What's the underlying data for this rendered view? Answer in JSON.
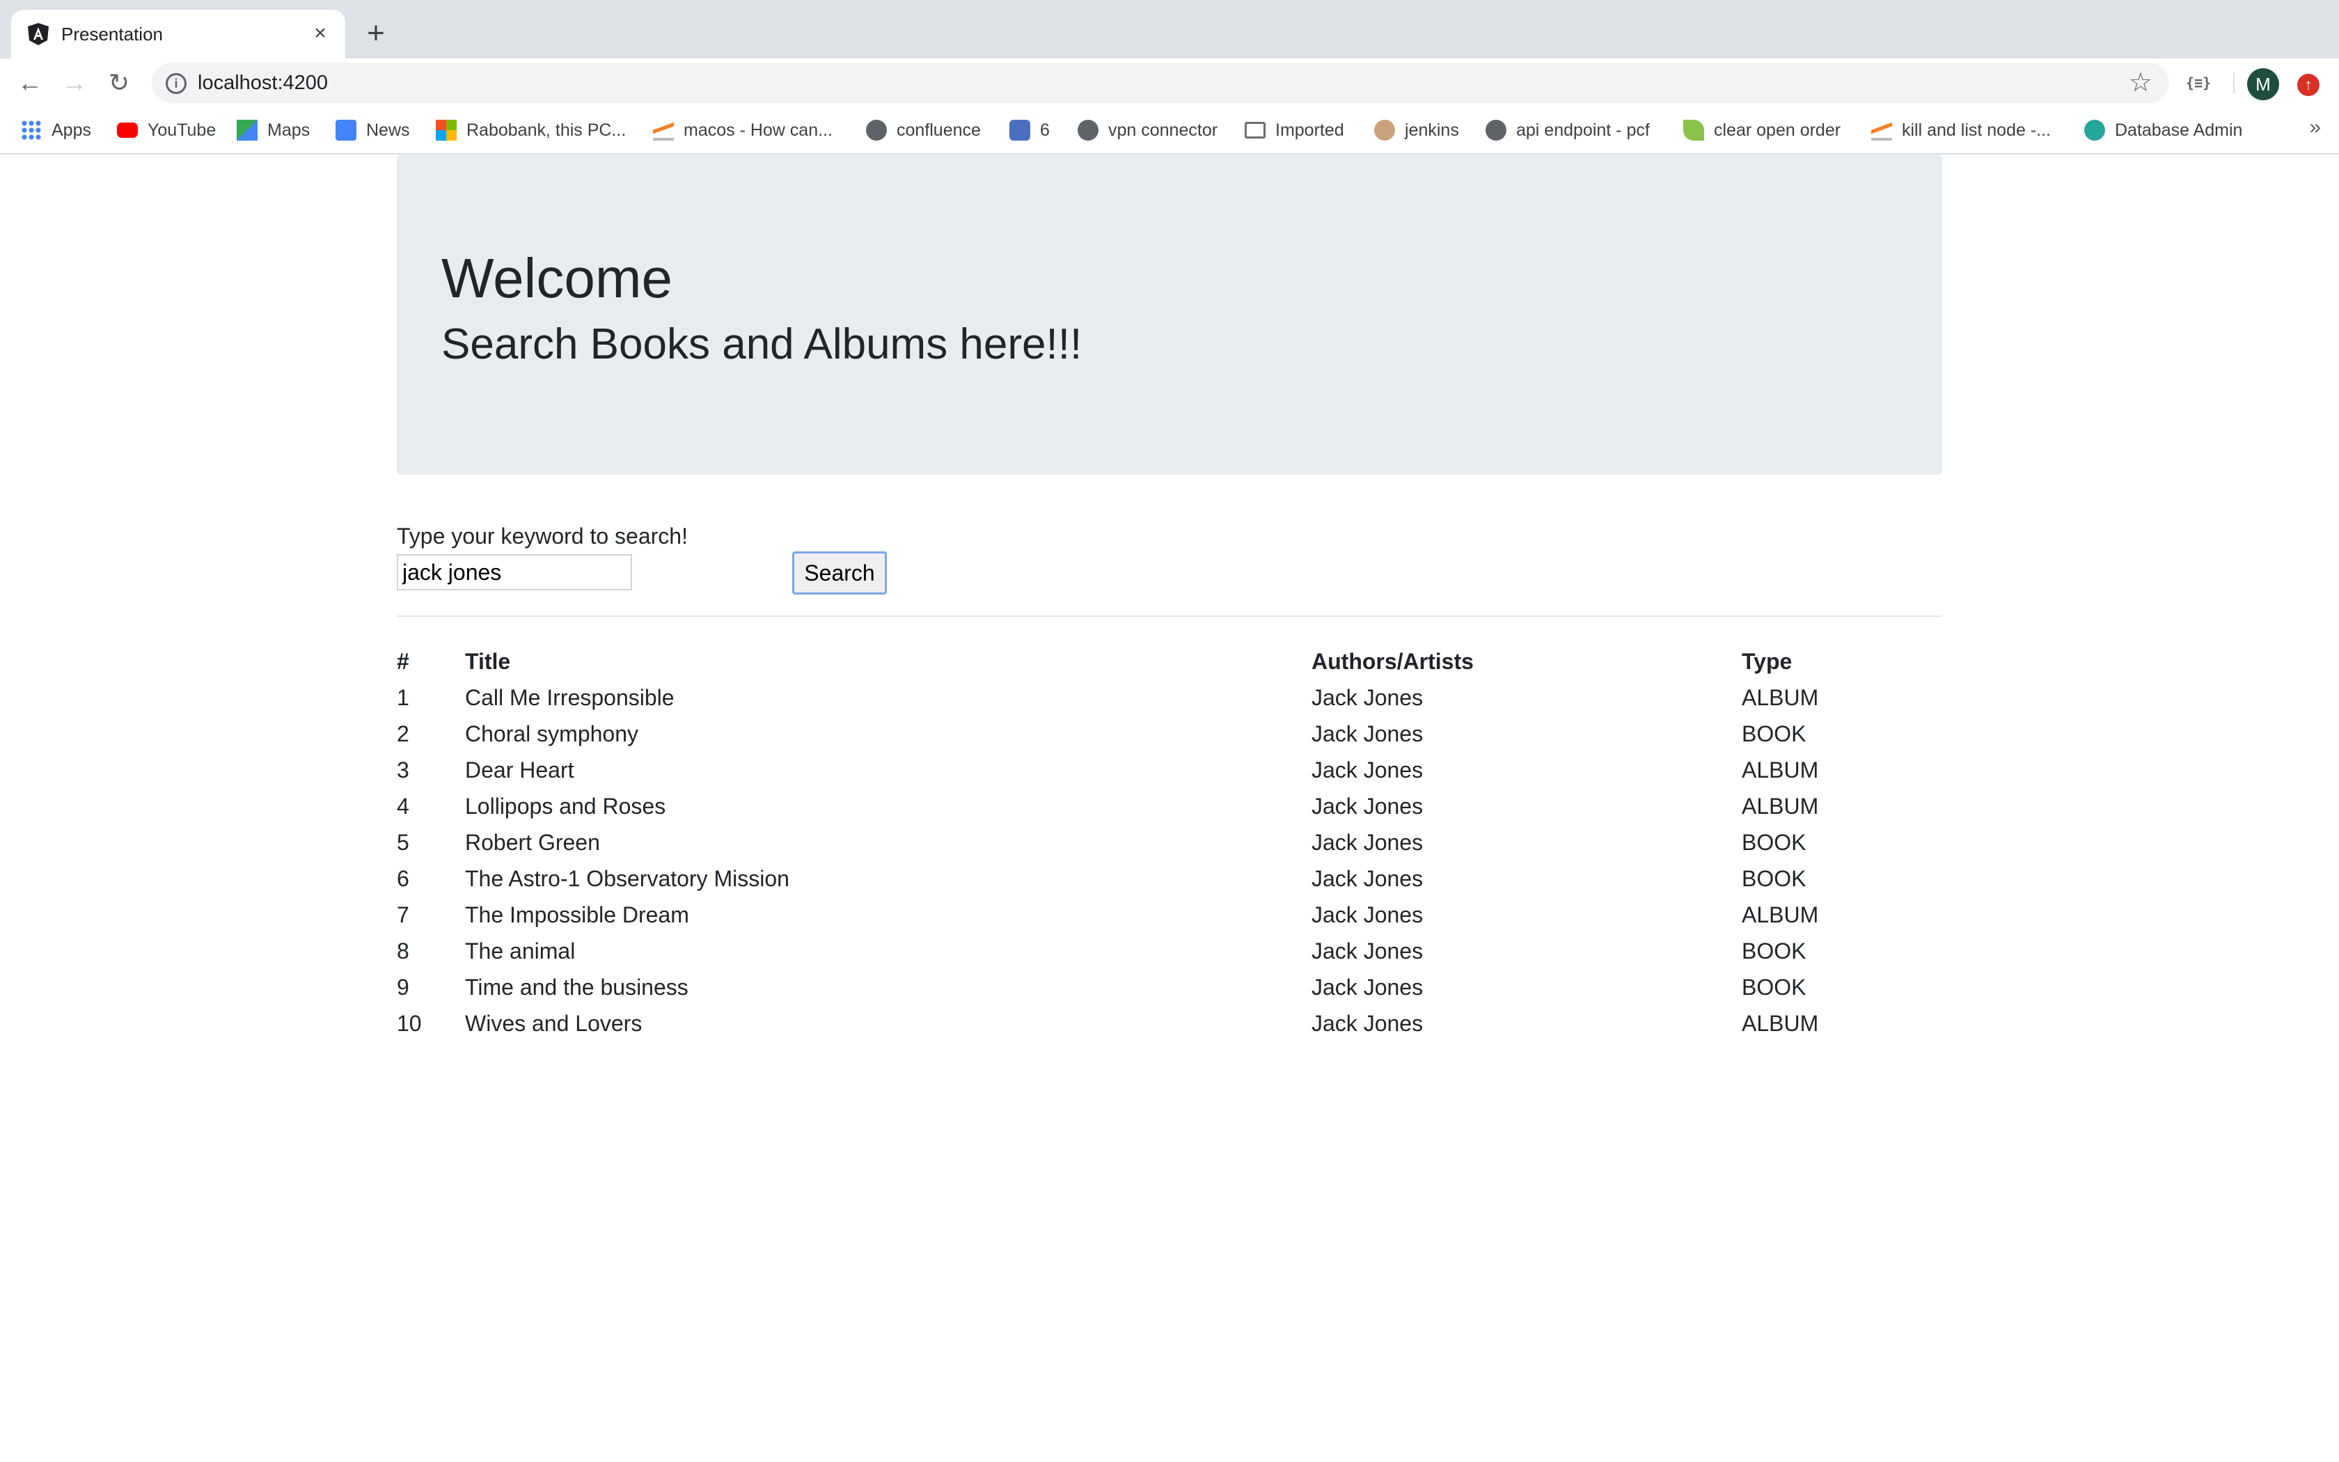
{
  "browser": {
    "tab_title": "Presentation",
    "tab_close": "×",
    "new_tab": "+",
    "url": "localhost:4200",
    "avatar_letter": "M",
    "ext_label": "{≡}"
  },
  "bookmarks": [
    {
      "label": "Apps",
      "icon": "apps-grid-icon",
      "color": "#4285f4"
    },
    {
      "label": "YouTube",
      "icon": "youtube-icon",
      "color": "#ff0000"
    },
    {
      "label": "Maps",
      "icon": "maps-icon",
      "color": "#34a853"
    },
    {
      "label": "News",
      "icon": "news-icon",
      "color": "#4285f4"
    },
    {
      "label": "Rabobank, this PC...",
      "icon": "windows-icon",
      "color": "#f25022"
    },
    {
      "label": "macos - How can...",
      "icon": "stackoverflow-icon",
      "color": "#f48024"
    },
    {
      "label": "confluence",
      "icon": "globe-icon",
      "color": "#5f6368"
    },
    {
      "label": "6",
      "icon": "robot-icon",
      "color": "#4a6fbf"
    },
    {
      "label": "vpn connector",
      "icon": "globe-icon",
      "color": "#5f6368"
    },
    {
      "label": "Imported",
      "icon": "folder-icon",
      "color": "#6e6e6e"
    },
    {
      "label": "jenkins",
      "icon": "jenkins-icon",
      "color": "#c9a27c"
    },
    {
      "label": "api endpoint - pcf",
      "icon": "globe-icon",
      "color": "#5f6368"
    },
    {
      "label": "clear open order",
      "icon": "leaf-icon",
      "color": "#8bc34a"
    },
    {
      "label": "kill and list node -...",
      "icon": "stackoverflow-icon",
      "color": "#f48024"
    },
    {
      "label": "Database Admin",
      "icon": "heartbeat-icon",
      "color": "#26a69a"
    }
  ],
  "page": {
    "welcome": "Welcome",
    "subtitle": "Search Books and Albums here!!!",
    "search_label": "Type your keyword to search!",
    "search_value": "jack jones",
    "search_button": "Search"
  },
  "table": {
    "headers": [
      "#",
      "Title",
      "Authors/Artists",
      "Type"
    ],
    "rows": [
      [
        "1",
        "Call Me Irresponsible",
        "Jack Jones",
        "ALBUM"
      ],
      [
        "2",
        "Choral symphony",
        "Jack Jones",
        "BOOK"
      ],
      [
        "3",
        "Dear Heart",
        "Jack Jones",
        "ALBUM"
      ],
      [
        "4",
        "Lollipops and Roses",
        "Jack Jones",
        "ALBUM"
      ],
      [
        "5",
        "Robert Green",
        "Jack Jones",
        "BOOK"
      ],
      [
        "6",
        "The Astro-1 Observatory Mission",
        "Jack Jones",
        "BOOK"
      ],
      [
        "7",
        "The Impossible Dream",
        "Jack Jones",
        "ALBUM"
      ],
      [
        "8",
        "The animal",
        "Jack Jones",
        "BOOK"
      ],
      [
        "9",
        "Time and the business",
        "Jack Jones",
        "BOOK"
      ],
      [
        "10",
        "Wives and Lovers",
        "Jack Jones",
        "ALBUM"
      ]
    ]
  }
}
